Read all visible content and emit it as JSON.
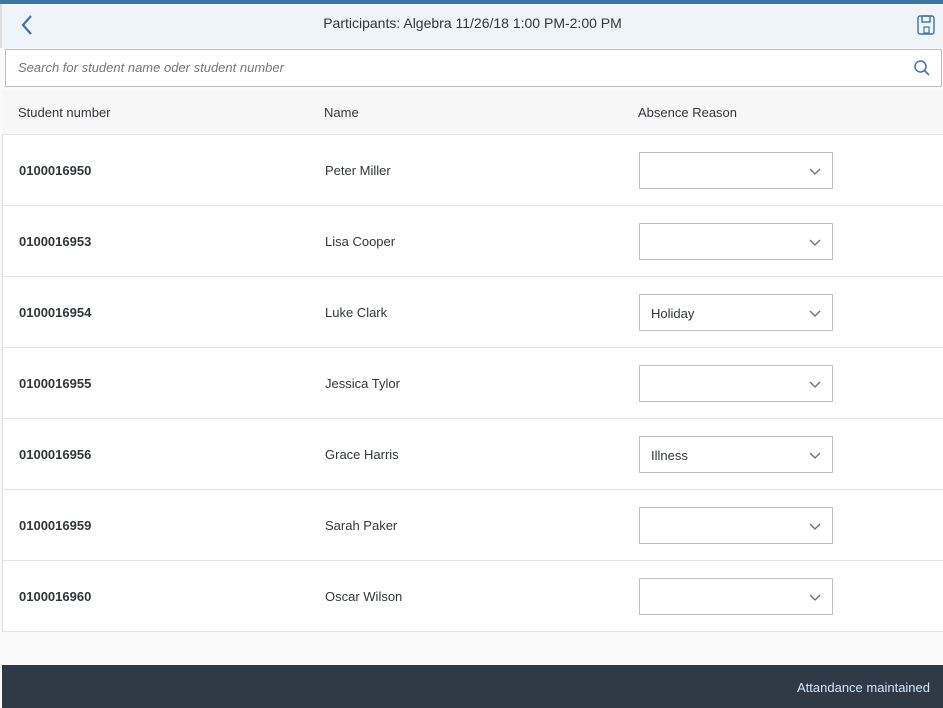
{
  "header": {
    "title": "Participants: Algebra 11/26/18 1:00 PM-2:00 PM"
  },
  "search": {
    "placeholder": "Search for student name oder student number",
    "value": ""
  },
  "table": {
    "columns": [
      "Student number",
      "Name",
      "Absence Reason"
    ],
    "rows": [
      {
        "number": "0100016950",
        "name": "Peter Miller",
        "reason": ""
      },
      {
        "number": "0100016953",
        "name": "Lisa Cooper",
        "reason": ""
      },
      {
        "number": "0100016954",
        "name": "Luke Clark",
        "reason": "Holiday"
      },
      {
        "number": "0100016955",
        "name": "Jessica Tylor",
        "reason": ""
      },
      {
        "number": "0100016956",
        "name": "Grace Harris",
        "reason": "Illness"
      },
      {
        "number": "0100016959",
        "name": "Sarah Paker",
        "reason": ""
      },
      {
        "number": "0100016960",
        "name": "Oscar Wilson",
        "reason": ""
      }
    ]
  },
  "footer": {
    "action_label": "Attandance maintained"
  }
}
